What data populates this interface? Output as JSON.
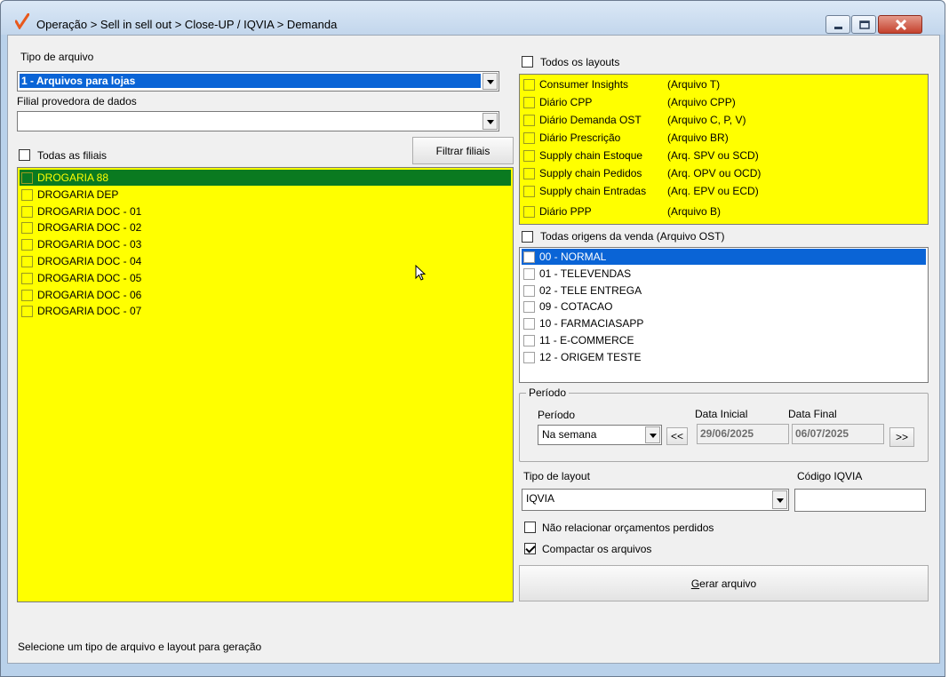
{
  "window": {
    "title": "Operação > Sell in sell out > Close-UP / IQVIA > Demanda",
    "minimize_icon": "minimize-icon",
    "maximize_icon": "maximize-icon",
    "close_icon": "close-icon"
  },
  "left": {
    "tipo_arquivo_label": "Tipo de arquivo",
    "tipo_arquivo_value": "1 - Arquivos para lojas",
    "filial_provedora_label": "Filial provedora de dados",
    "filial_provedora_value": "",
    "todas_filiais_label": "Todas as filiais",
    "filtrar_filiais_label": "Filtrar filiais",
    "filiais": [
      {
        "name": "DROGARIA 88",
        "selected": true
      },
      {
        "name": "DROGARIA DEP",
        "selected": false
      },
      {
        "name": "DROGARIA DOC - 01",
        "selected": false
      },
      {
        "name": "DROGARIA DOC - 02",
        "selected": false
      },
      {
        "name": "DROGARIA DOC - 03",
        "selected": false
      },
      {
        "name": "DROGARIA DOC - 04",
        "selected": false
      },
      {
        "name": "DROGARIA DOC - 05",
        "selected": false
      },
      {
        "name": "DROGARIA DOC - 06",
        "selected": false
      },
      {
        "name": "DROGARIA DOC - 07",
        "selected": false
      }
    ]
  },
  "right": {
    "todos_layouts_label": "Todos os layouts",
    "layouts": [
      {
        "name": "Consumer Insights",
        "file": "(Arquivo T)"
      },
      {
        "name": "Diário CPP",
        "file": "(Arquivo CPP)"
      },
      {
        "name": "Diário Demanda OST",
        "file": "(Arquivo C, P, V)"
      },
      {
        "name": "Diário Prescrição",
        "file": "(Arquivo BR)"
      },
      {
        "name": "Supply chain Estoque",
        "file": "(Arq. SPV ou SCD)"
      },
      {
        "name": "Supply chain Pedidos",
        "file": "(Arq. OPV ou OCD)"
      },
      {
        "name": " Supply chain Entradas",
        "file": "(Arq. EPV ou ECD)"
      },
      {
        "name": "Diário PPP",
        "file": "(Arquivo B)"
      }
    ],
    "todas_origens_label": "Todas origens da venda (Arquivo OST)",
    "origens": [
      {
        "name": "00 - NORMAL",
        "selected": true
      },
      {
        "name": "01 - TELEVENDAS",
        "selected": false
      },
      {
        "name": "02 - TELE ENTREGA",
        "selected": false
      },
      {
        "name": "09 - COTACAO",
        "selected": false
      },
      {
        "name": "10 - FARMACIASAPP",
        "selected": false
      },
      {
        "name": "11 - E-COMMERCE",
        "selected": false
      },
      {
        "name": "12 - ORIGEM TESTE",
        "selected": false
      }
    ],
    "periodo_group_title": "Período",
    "periodo_label": "Período",
    "periodo_value": "Na semana",
    "data_inicial_label": "Data Inicial",
    "data_inicial_value": "29/06/2025",
    "data_final_label": "Data Final",
    "data_final_value": "06/07/2025",
    "prev_label": "<<",
    "next_label": ">>",
    "tipo_layout_label": "Tipo de layout",
    "tipo_layout_value": "IQVIA",
    "codigo_iqvia_label": "Código IQVIA",
    "codigo_iqvia_value": "",
    "nao_relacionar_label": "Não relacionar orçamentos perdidos",
    "nao_relacionar_checked": false,
    "compactar_label": "Compactar os arquivos",
    "compactar_checked": true,
    "gerar_arquivo_label": "Gerar arquivo",
    "gerar_arquivo_mnemonic": "G",
    "gerar_arquivo_rest": "erar arquivo"
  },
  "status_text": "Selecione um tipo de arquivo e layout para geração",
  "colors": {
    "list_background": "#ffff00",
    "selected_green": "#0a7a20",
    "selected_blue": "#0a64d6"
  }
}
